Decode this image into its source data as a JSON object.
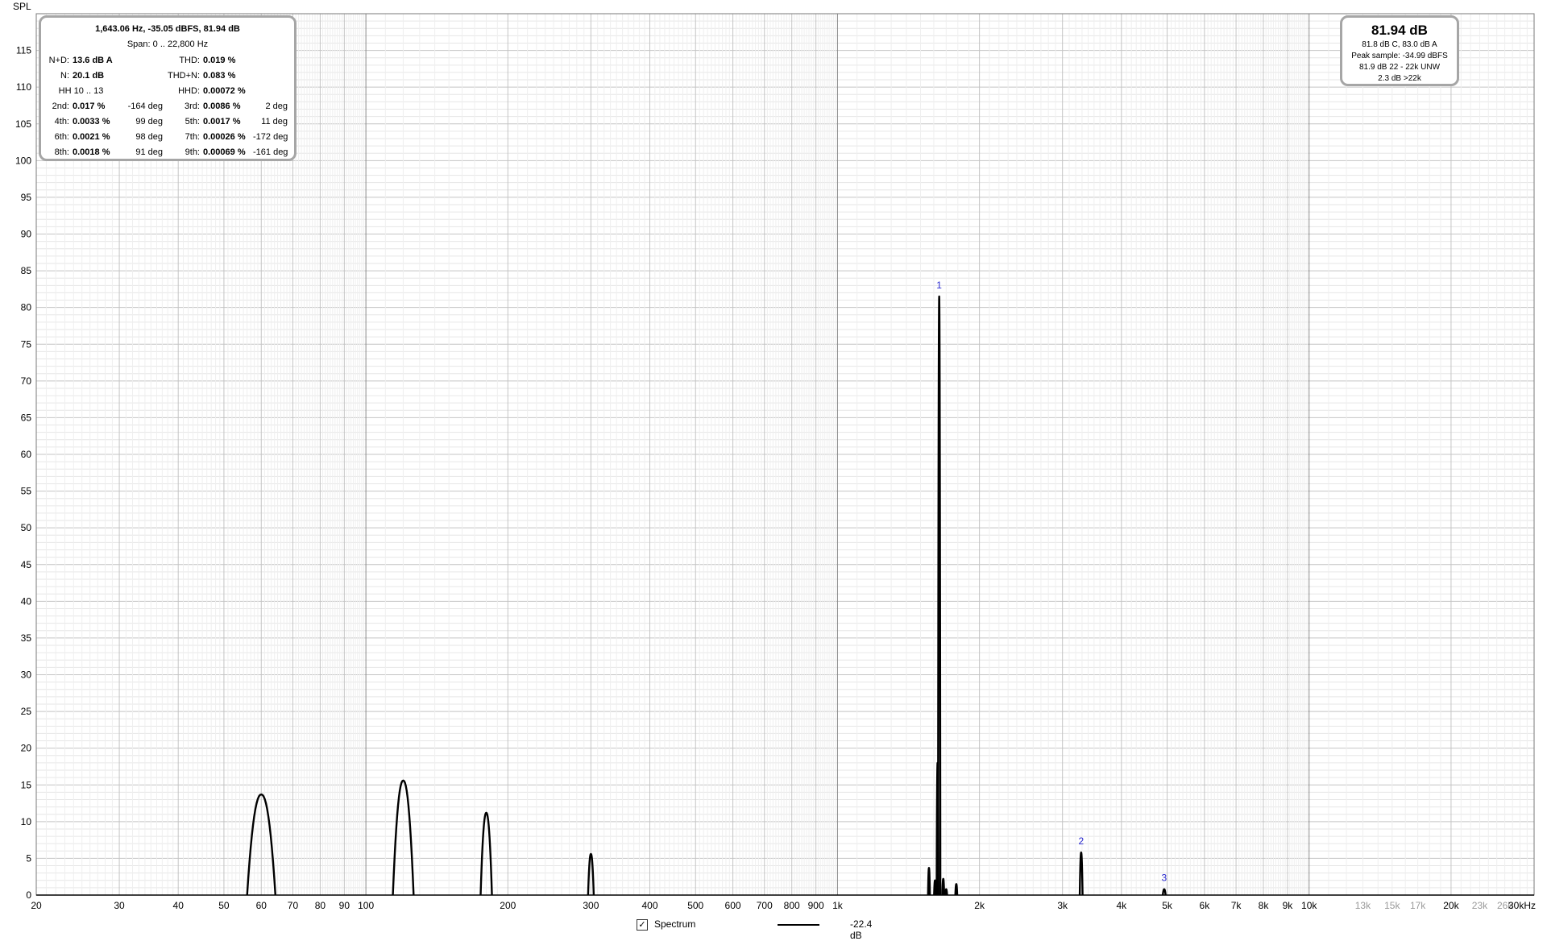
{
  "chart_data": {
    "type": "line",
    "title": "",
    "xlabel": "",
    "ylabel": "SPL",
    "x_scale": "log",
    "xlim": [
      20,
      30000
    ],
    "ylim": [
      0,
      120
    ],
    "grid": true,
    "y_ticks": [
      0,
      5,
      10,
      15,
      20,
      25,
      30,
      35,
      40,
      45,
      50,
      55,
      60,
      65,
      70,
      75,
      80,
      85,
      90,
      95,
      100,
      105,
      110,
      115
    ],
    "x_ticks": [
      {
        "v": 20,
        "label": "20"
      },
      {
        "v": 30,
        "label": "30"
      },
      {
        "v": 40,
        "label": "40"
      },
      {
        "v": 50,
        "label": "50"
      },
      {
        "v": 60,
        "label": "60"
      },
      {
        "v": 70,
        "label": "70"
      },
      {
        "v": 80,
        "label": "80"
      },
      {
        "v": 90,
        "label": "90"
      },
      {
        "v": 100,
        "label": "100"
      },
      {
        "v": 200,
        "label": "200"
      },
      {
        "v": 300,
        "label": "300"
      },
      {
        "v": 400,
        "label": "400"
      },
      {
        "v": 500,
        "label": "500"
      },
      {
        "v": 600,
        "label": "600"
      },
      {
        "v": 700,
        "label": "700"
      },
      {
        "v": 800,
        "label": "800"
      },
      {
        "v": 900,
        "label": "900"
      },
      {
        "v": 1000,
        "label": "1k"
      },
      {
        "v": 2000,
        "label": "2k"
      },
      {
        "v": 3000,
        "label": "3k"
      },
      {
        "v": 4000,
        "label": "4k"
      },
      {
        "v": 5000,
        "label": "5k"
      },
      {
        "v": 6000,
        "label": "6k"
      },
      {
        "v": 7000,
        "label": "7k"
      },
      {
        "v": 8000,
        "label": "8k"
      },
      {
        "v": 9000,
        "label": "9k"
      },
      {
        "v": 10000,
        "label": "10k"
      },
      {
        "v": 13000,
        "label": "13k",
        "minor": true
      },
      {
        "v": 15000,
        "label": "15k",
        "minor": true
      },
      {
        "v": 17000,
        "label": "17k",
        "minor": true
      },
      {
        "v": 20000,
        "label": "20k"
      },
      {
        "v": 23000,
        "label": "23k",
        "minor": true
      },
      {
        "v": 26000,
        "label": "26k",
        "minor": true
      },
      {
        "v": 30000,
        "label": "30kHz"
      }
    ],
    "series": [
      {
        "name": "Spectrum",
        "peaks": [
          {
            "freq": 60,
            "level": 13.7,
            "width": 0.03
          },
          {
            "freq": 120,
            "level": 15.6,
            "width": 0.022
          },
          {
            "freq": 180,
            "level": 11.2,
            "width": 0.012
          },
          {
            "freq": 300,
            "level": 5.6,
            "width": 0.006
          },
          {
            "freq": 1563,
            "level": 3.7,
            "width": 0.002
          },
          {
            "freq": 1610,
            "level": 2.0,
            "width": 0.002
          },
          {
            "freq": 1630,
            "level": 18.0,
            "width": 0.002
          },
          {
            "freq": 1643.06,
            "level": 81.5,
            "width": 0.0025
          },
          {
            "freq": 1676,
            "level": 2.2,
            "width": 0.002
          },
          {
            "freq": 1700,
            "level": 0.8,
            "width": 0.002
          },
          {
            "freq": 1786,
            "level": 1.5,
            "width": 0.002
          },
          {
            "freq": 3286,
            "level": 5.8,
            "width": 0.003
          },
          {
            "freq": 4929,
            "level": 0.8,
            "width": 0.003
          }
        ]
      }
    ],
    "markers": [
      {
        "label": "1",
        "freq": 1643.06,
        "level": 81.5
      },
      {
        "label": "2",
        "freq": 3286,
        "level": 5.8
      },
      {
        "label": "3",
        "freq": 4929,
        "level": 0.8
      }
    ],
    "legend": {
      "placement": "bottom-center",
      "checkbox": "✓",
      "name": "Spectrum",
      "value": "-22.4 dB"
    }
  },
  "distortion_panel": {
    "header": "1,643.06 Hz, -35.05 dBFS, 81.94 dB",
    "span": "Span: 0 .. 22,800 Hz",
    "nd_label": "N+D:",
    "nd_value": "13.6 dB A",
    "thd_label": "THD:",
    "thd_value": "0.019 %",
    "n_label": "N:",
    "n_value": "20.1 dB",
    "thdn_label": "THD+N:",
    "thdn_value": "0.083 %",
    "hh_label": "HH 10 .. 13",
    "hhd_label": "HHD:",
    "hhd_value": "0.00072 %",
    "harmonics": [
      {
        "l1": "2nd:",
        "v1": "0.017 %",
        "d1": "-164 deg",
        "l2": "3rd:",
        "v2": "0.0086 %",
        "d2": "2 deg"
      },
      {
        "l1": "4th:",
        "v1": "0.0033 %",
        "d1": "99 deg",
        "l2": "5th:",
        "v2": "0.0017 %",
        "d2": "11 deg"
      },
      {
        "l1": "6th:",
        "v1": "0.0021 %",
        "d1": "98 deg",
        "l2": "7th:",
        "v2": "0.00026 %",
        "d2": "-172 deg"
      },
      {
        "l1": "8th:",
        "v1": "0.0018 %",
        "d1": "91 deg",
        "l2": "9th:",
        "v2": "0.00069 %",
        "d2": "-161 deg"
      }
    ]
  },
  "spl_panel": {
    "main": "81.94 dB",
    "line1": "81.8 dB C, 83.0 dB A",
    "line2": "Peak sample: -34.99 dBFS",
    "line3": "81.9 dB 22 - 22k UNW",
    "line4": "2.3 dB >22k"
  }
}
